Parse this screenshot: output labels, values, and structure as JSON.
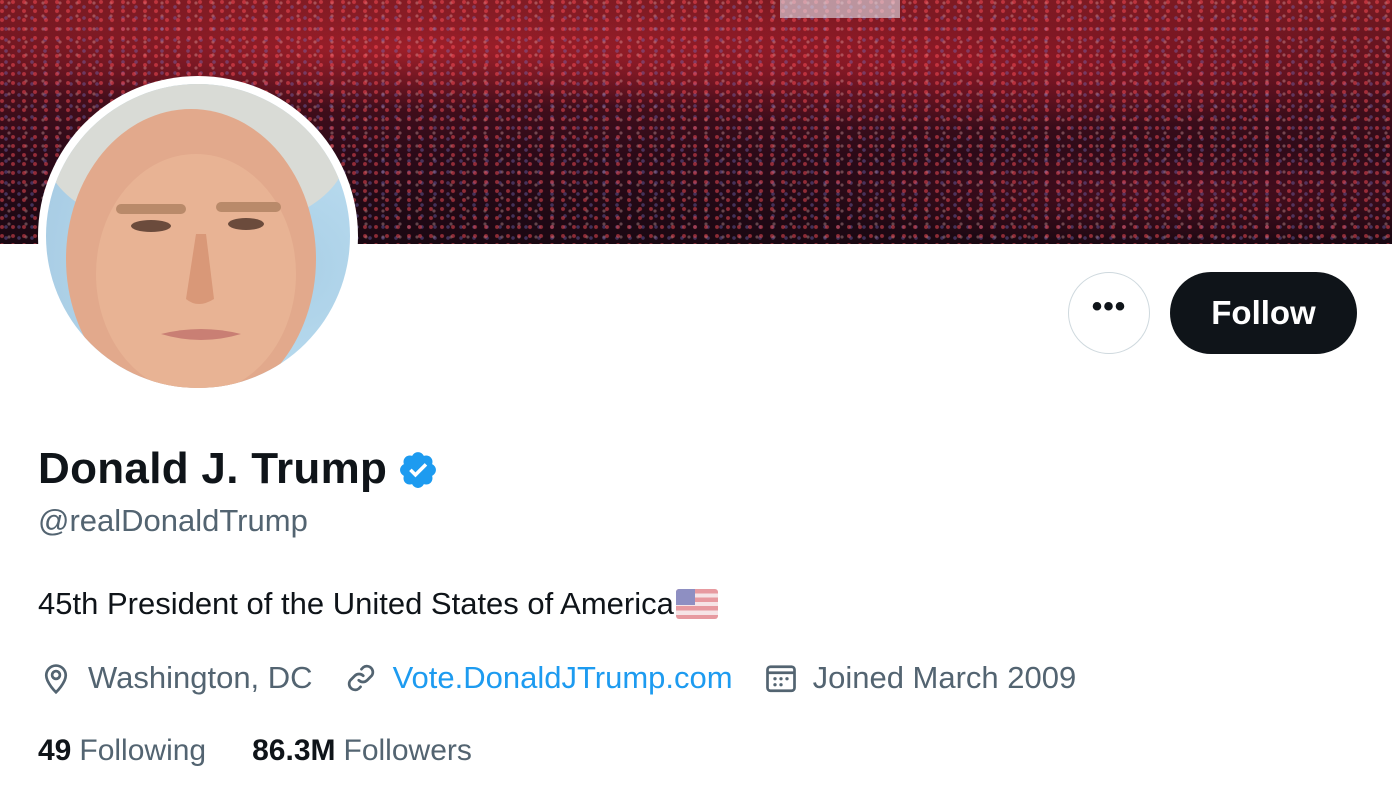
{
  "profile": {
    "display_name": "Donald J. Trump",
    "handle": "@realDonaldTrump",
    "bio": "45th President of the United States of America",
    "bio_emoji": "us-flag",
    "location": "Washington, DC",
    "website": "Vote.DonaldJTrump.com",
    "joined": "Joined March 2009",
    "verified": true
  },
  "actions": {
    "more_label": "•••",
    "follow_label": "Follow"
  },
  "stats": {
    "following_count": "49",
    "following_label": "Following",
    "followers_count": "86.3M",
    "followers_label": "Followers"
  },
  "icons": {
    "location": "location-pin-icon",
    "link": "link-icon",
    "calendar": "calendar-icon",
    "verified": "verified-badge-icon"
  },
  "colors": {
    "text_primary": "#0f1419",
    "text_secondary": "#536471",
    "link": "#1d9bf0",
    "verified": "#1d9bf0",
    "follow_bg": "#0f1419",
    "border": "#cfd9de"
  }
}
